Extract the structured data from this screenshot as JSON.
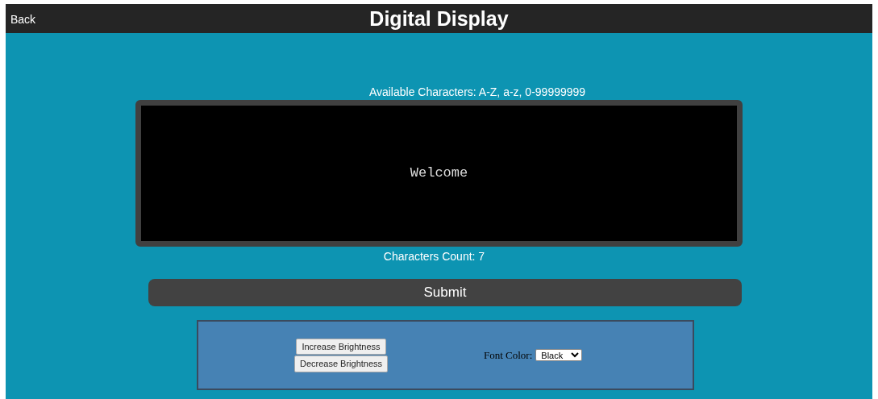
{
  "header": {
    "back": "Back",
    "title": "Digital Display"
  },
  "available": "Available Characters: A-Z, a-z, 0-99999999",
  "display": {
    "text": "Welcome"
  },
  "count": "Characters Count: 7",
  "submit": "Submit",
  "controls": {
    "buttons": [
      "Increase Brightness",
      "Decrease Brightness"
    ],
    "font_color_label": "Font Color:",
    "font_color": "Black"
  }
}
